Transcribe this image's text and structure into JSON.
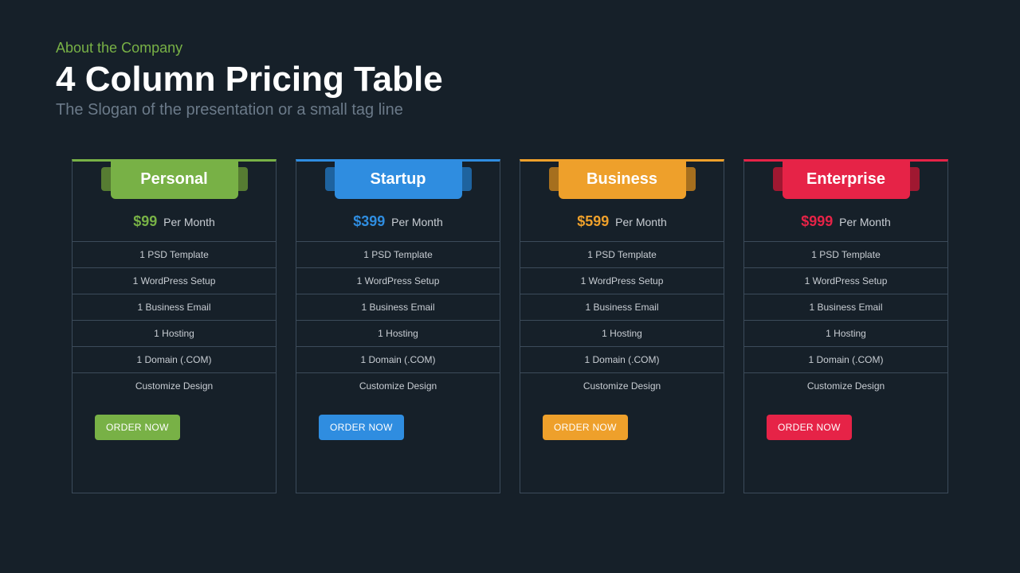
{
  "header": {
    "eyebrow": "About the Company",
    "title": "4 Column Pricing Table",
    "subtitle": "The Slogan of the presentation or a small tag line"
  },
  "common": {
    "per": "Per Month",
    "cta": "ORDER NOW"
  },
  "plans": [
    {
      "name": "Personal",
      "price": "$99",
      "color": "#78b146",
      "shade": "#567c32",
      "features": [
        "1 PSD Template",
        "1 WordPress Setup",
        "1 Business Email",
        "1 Hosting",
        "1 Domain (.COM)",
        "Customize Design"
      ]
    },
    {
      "name": "Startup",
      "price": "$399",
      "color": "#2f8de0",
      "shade": "#1e639f",
      "features": [
        "1 PSD Template",
        "1 WordPress Setup",
        "1 Business Email",
        "1 Hosting",
        "1 Domain (.COM)",
        "Customize Design"
      ]
    },
    {
      "name": "Business",
      "price": "$599",
      "color": "#eea02b",
      "shade": "#a66f1e",
      "features": [
        "1 PSD Template",
        "1 WordPress Setup",
        "1 Business Email",
        "1 Hosting",
        "1 Domain (.COM)",
        "Customize Design"
      ]
    },
    {
      "name": "Enterprise",
      "price": "$999",
      "color": "#e62347",
      "shade": "#a01831",
      "features": [
        "1 PSD Template",
        "1 WordPress Setup",
        "1 Business Email",
        "1 Hosting",
        "1 Domain (.COM)",
        "Customize Design"
      ]
    }
  ]
}
